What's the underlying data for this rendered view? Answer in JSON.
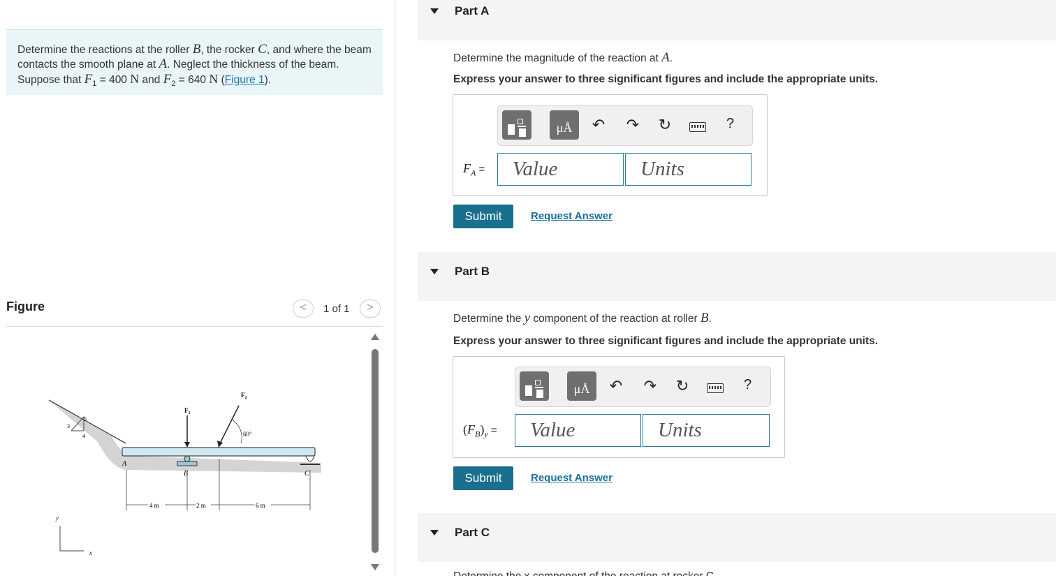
{
  "problem": {
    "text_1": "Determine the reactions at the roller ",
    "sym_B": "B",
    "text_2": ", the rocker ",
    "sym_C": "C",
    "text_3": ", and where the beam contacts the smooth plane at ",
    "sym_A": "A",
    "text_4": ". Neglect the thickness of the beam. Suppose that ",
    "sym_F1": "F",
    "sub_F1": "1",
    "eq_F1": " = 400 ",
    "unit_N1": "N",
    "text_and": " and ",
    "sym_F2": "F",
    "sub_F2": "2",
    "eq_F2": " = 640 ",
    "unit_N2": "N",
    "paren_open": " (",
    "figure_link": "Figure 1",
    "paren_close": ")."
  },
  "figure_panel": {
    "title": "Figure",
    "pager": "1 of 1",
    "prev": "<",
    "next": ">",
    "labels": {
      "F1": "F",
      "F1_sub": "1",
      "F2": "F",
      "F2_sub": "2",
      "angle": "60°",
      "A": "A",
      "B": "B",
      "C": "C",
      "slope_3": "3",
      "slope_4": "4",
      "slope_5": "5",
      "dim_4m": "4 m",
      "dim_2m": "2 m",
      "dim_6m": "6 m",
      "axis_x": "x",
      "axis_y": "y"
    }
  },
  "parts": [
    {
      "title": "Part A",
      "prompt_1": "Determine the magnitude of the reaction at ",
      "prompt_sym": "A",
      "prompt_2": ".",
      "instruction": "Express your answer to three significant figures and include the appropriate units.",
      "label": "F",
      "label_sub": "A",
      "label_eq": " =",
      "value_placeholder": "Value",
      "units_placeholder": "Units",
      "submit": "Submit",
      "request": "Request Answer"
    },
    {
      "title": "Part B",
      "prompt_1": "Determine the ",
      "prompt_sym_y": "y",
      "prompt_mid": " component of the reaction at roller ",
      "prompt_sym": "B",
      "prompt_2": ".",
      "instruction": "Express your answer to three significant figures and include the appropriate units.",
      "label_open": "(",
      "label": "F",
      "label_sub": "B",
      "label_close": ")",
      "label_sub2": "y",
      "label_eq": " =",
      "value_placeholder": "Value",
      "units_placeholder": "Units",
      "submit": "Submit",
      "request": "Request Answer"
    },
    {
      "title": "Part C",
      "prompt_cut": "Determine the x component of the reaction at rocker C."
    }
  ],
  "toolbar": {
    "units_glyph": "μÅ",
    "undo": "↶",
    "redo": "↷",
    "reset": "↻",
    "help": "?"
  },
  "colors": {
    "problem_bg": "#e9f5f6",
    "part_header_bg": "#f4f4f4",
    "submit_bg": "#1a6f8f",
    "link": "#1a6f9c",
    "field_border": "#2a7f95",
    "beam_fill": "#cfe8f0"
  }
}
